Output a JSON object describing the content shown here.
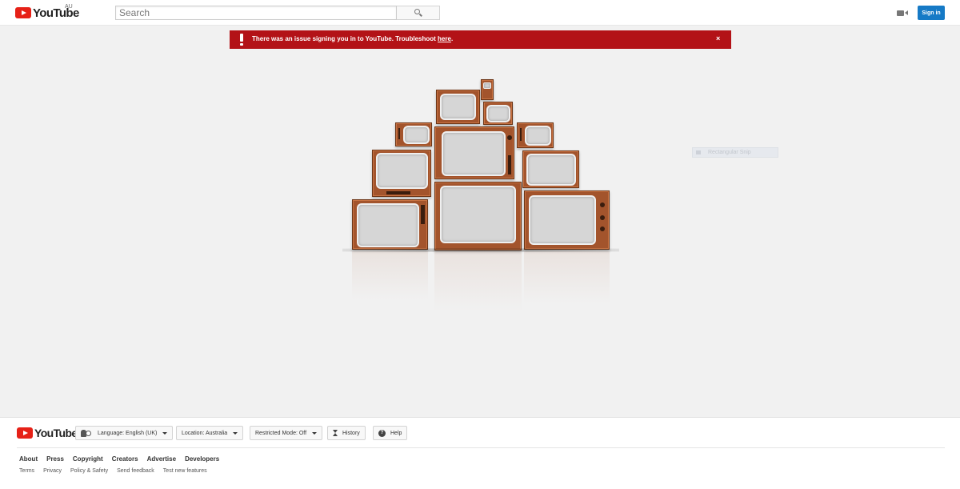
{
  "header": {
    "logo_text": "YouTube",
    "region_code": "AU",
    "search_placeholder": "Search",
    "signin_label": "Sign in"
  },
  "alert": {
    "message": "There was an issue signing you in to YouTube. Troubleshoot ",
    "link_text": "here",
    "message_end": ".",
    "close_glyph": "×"
  },
  "overlay": {
    "snip_label": "Rectangular Snip"
  },
  "footer": {
    "logo_text": "YouTube",
    "language_label": "Language: English (UK)",
    "location_label": "Location: Australia",
    "restricted_label": "Restricted Mode: Off",
    "history_label": "History",
    "help_label": "Help",
    "primary_links": [
      "About",
      "Press",
      "Copyright",
      "Creators",
      "Advertise",
      "Developers"
    ],
    "secondary_links": [
      "Terms",
      "Privacy",
      "Policy & Safety",
      "Send feedback",
      "Test new features"
    ]
  },
  "colors": {
    "brand_red": "#e62117",
    "alert_red": "#b31217",
    "signin_blue": "#167ac6",
    "tv_wood": "#a3542c"
  }
}
